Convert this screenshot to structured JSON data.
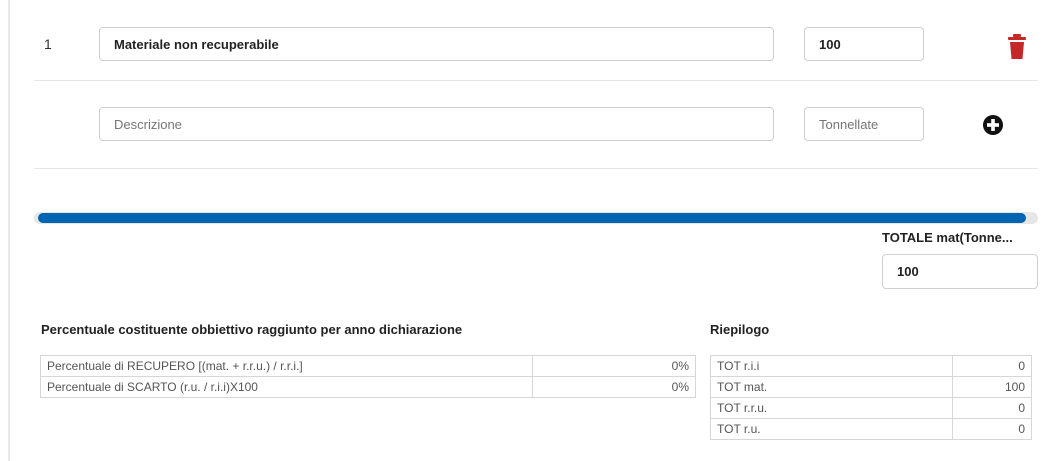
{
  "items": [
    {
      "index": "1",
      "description": "Materiale non recuperabile",
      "quantity": "100"
    }
  ],
  "new_item": {
    "description_placeholder": "Descrizione",
    "quantity_placeholder": "Tonnellate"
  },
  "icons": {
    "delete": "trash-icon",
    "add": "plus-circle-icon"
  },
  "colors": {
    "delete": "#c62828",
    "scrollbar": "#0066b3"
  },
  "total": {
    "label": "TOTALE mat(Tonne...",
    "value": "100"
  },
  "percentages": {
    "title": "Percentuale costituente obbiettivo raggiunto per anno dichiarazione",
    "rows": [
      {
        "label": "Percentuale di RECUPERO [(mat. + r.r.u.) / r.r.i.]",
        "value": "0%"
      },
      {
        "label": "Percentuale di SCARTO (r.u. / r.i.i)X100",
        "value": "0%"
      }
    ]
  },
  "summary": {
    "title": "Riepilogo",
    "rows": [
      {
        "label": "TOT r.i.i",
        "value": "0"
      },
      {
        "label": "TOT mat.",
        "value": "100"
      },
      {
        "label": "TOT r.r.u.",
        "value": "0"
      },
      {
        "label": "TOT r.u.",
        "value": "0"
      }
    ]
  }
}
